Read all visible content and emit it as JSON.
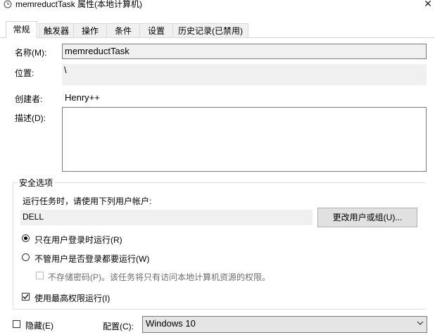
{
  "window": {
    "title": "memreductTask 属性(本地计算机)",
    "close_glyph": "✕"
  },
  "tabs": [
    {
      "label": "常规",
      "active": true
    },
    {
      "label": "触发器"
    },
    {
      "label": "操作"
    },
    {
      "label": "条件"
    },
    {
      "label": "设置"
    },
    {
      "label": "历史记录(已禁用)"
    }
  ],
  "general": {
    "name_label": "名称(M):",
    "name_value": "memreductTask",
    "location_label": "位置:",
    "location_value": "\\",
    "author_label": "创建者:",
    "author_value": "Henry++",
    "description_label": "描述(D):",
    "description_value": ""
  },
  "security": {
    "legend": "安全选项",
    "run_as_prompt": "运行任务时，请使用下列用户帐户:",
    "user_account": "DELL",
    "change_user_button": "更改用户或组(U)...",
    "radio_logged_on": "只在用户登录时运行(R)",
    "radio_whether_logged_on": "不管用户是否登录都要运行(W)",
    "do_not_store_password": "不存储密码(P)。该任务将只有访问本地计算机资源的权限。",
    "highest_privileges": "使用最高权限运行(I)",
    "highest_privileges_checked": true
  },
  "footer": {
    "hidden_label": "隐藏(E)",
    "config_label": "配置(C):",
    "config_value": "Windows 10"
  },
  "colors": {
    "field_bg": "#f0f0f0",
    "border": "#7a7a7a",
    "button_bg": "#e1e1e1"
  }
}
